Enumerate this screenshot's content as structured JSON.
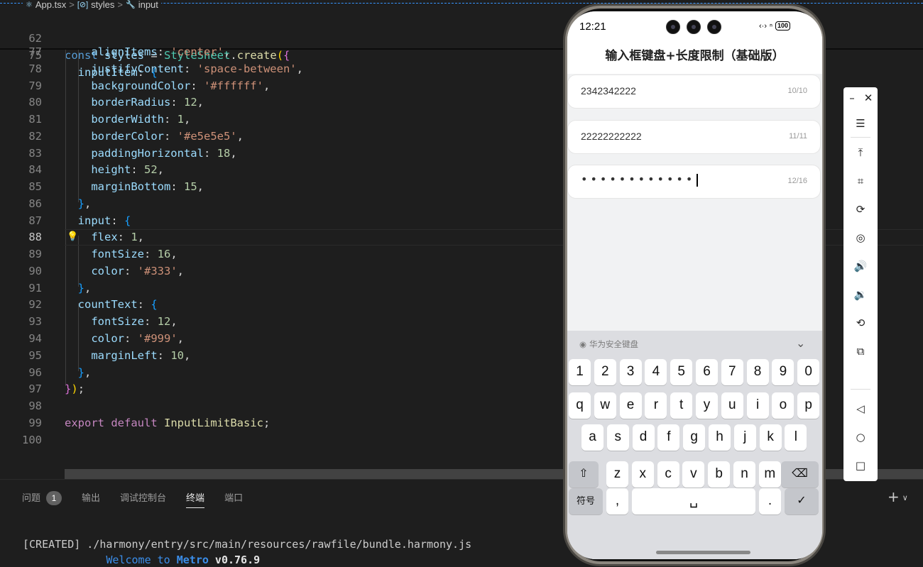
{
  "breadcrumb": {
    "file": "App.tsx",
    "symbol1": "styles",
    "symbol2": "input"
  },
  "code": {
    "sticky1": {
      "num": "62",
      "text": "const styles = StyleSheet.create({"
    },
    "sticky2": {
      "num": "75",
      "text": "  inputItem: {"
    },
    "lines": [
      {
        "num": "77",
        "text": "alignItems: 'center',"
      },
      {
        "num": "78",
        "text": "justifyContent: 'space-between',"
      },
      {
        "num": "79",
        "text": "backgroundColor: '#ffffff',"
      },
      {
        "num": "80",
        "text": "borderRadius: 12,"
      },
      {
        "num": "81",
        "text": "borderWidth: 1,"
      },
      {
        "num": "82",
        "text": "borderColor: '#e5e5e5',"
      },
      {
        "num": "83",
        "text": "paddingHorizontal: 18,"
      },
      {
        "num": "84",
        "text": "height: 52,"
      },
      {
        "num": "85",
        "text": "marginBottom: 15,"
      },
      {
        "num": "86",
        "text": "},"
      },
      {
        "num": "87",
        "text": "input: {"
      },
      {
        "num": "88",
        "text": "flex: 1,"
      },
      {
        "num": "89",
        "text": "fontSize: 16,"
      },
      {
        "num": "90",
        "text": "color: '#333',"
      },
      {
        "num": "91",
        "text": "},"
      },
      {
        "num": "92",
        "text": "countText: {"
      },
      {
        "num": "93",
        "text": "fontSize: 12,"
      },
      {
        "num": "94",
        "text": "color: '#999',"
      },
      {
        "num": "95",
        "text": "marginLeft: 10,"
      },
      {
        "num": "96",
        "text": "},"
      },
      {
        "num": "97",
        "text": "});"
      },
      {
        "num": "98",
        "text": ""
      },
      {
        "num": "99",
        "text": "export default InputLimitBasic;"
      },
      {
        "num": "100",
        "text": ""
      }
    ]
  },
  "panel": {
    "tabs": [
      {
        "label": "问题",
        "badge": "1"
      },
      {
        "label": "输出"
      },
      {
        "label": "调试控制台"
      },
      {
        "label": "终端",
        "active": true
      },
      {
        "label": "端口"
      }
    ],
    "terminal": {
      "line1": "[CREATED] ./harmony/entry/src/main/resources/rawfile/bundle.harmony.js",
      "welcome": "Welcome to ",
      "metro": "Metro",
      "version": " v0.76.9"
    }
  },
  "phone": {
    "time": "12:21",
    "battery": "100",
    "title": "输入框键盘+长度限制（基础版）",
    "fields": [
      {
        "value": "2342342222",
        "count": "10/10"
      },
      {
        "value": "22222222222",
        "count": "11/11"
      },
      {
        "value": "••••••••••••",
        "count": "12/16",
        "masked": true
      }
    ],
    "keyboard": {
      "title": "华为安全键盘",
      "row_digits": [
        "1",
        "2",
        "3",
        "4",
        "5",
        "6",
        "7",
        "8",
        "9",
        "0"
      ],
      "row1": [
        "q",
        "w",
        "e",
        "r",
        "t",
        "y",
        "u",
        "i",
        "o",
        "p"
      ],
      "row2": [
        "a",
        "s",
        "d",
        "f",
        "g",
        "h",
        "j",
        "k",
        "l"
      ],
      "row3": [
        "z",
        "x",
        "c",
        "v",
        "b",
        "n",
        "m"
      ],
      "symbols_label": "符号",
      "comma": ",",
      "period": "."
    }
  },
  "colors": {
    "editor_bg": "#1e1e1e",
    "accent": "#3794ff",
    "keyword": "#569cd6",
    "string": "#ce9178",
    "number": "#b5cea8"
  }
}
